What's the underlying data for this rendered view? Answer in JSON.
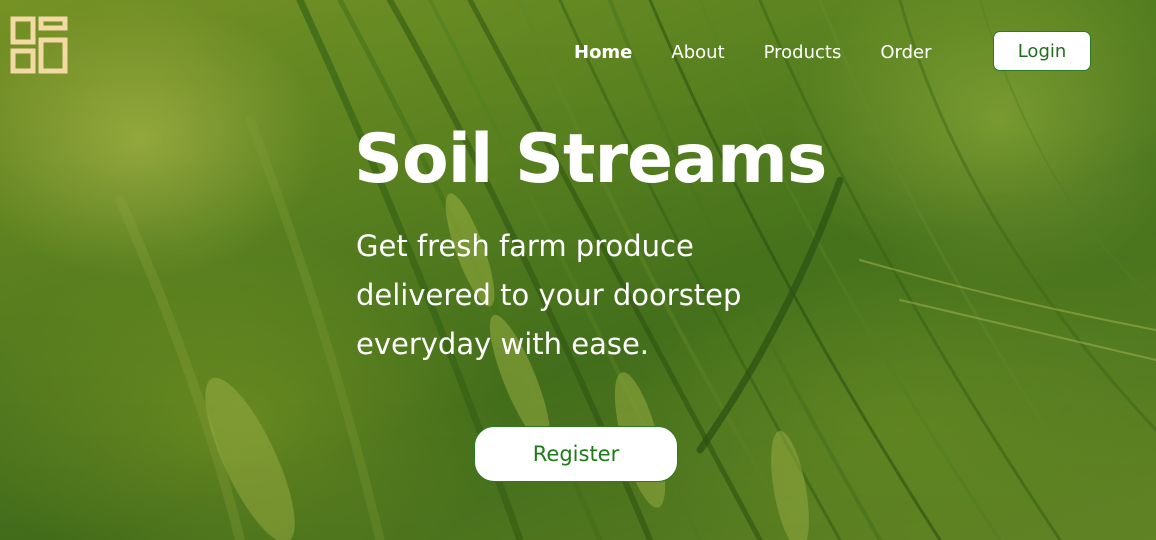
{
  "brand": {
    "logo_icon": "grid-squares-icon",
    "logo_color": "#f3d9a4"
  },
  "nav": {
    "items": [
      {
        "label": "Home",
        "active": true
      },
      {
        "label": "About",
        "active": false
      },
      {
        "label": "Products",
        "active": false
      },
      {
        "label": "Order",
        "active": false
      }
    ],
    "login_label": "Login"
  },
  "hero": {
    "title": "Soil Streams",
    "subtitle": "Get fresh farm produce delivered to your doorstep everyday with ease.",
    "cta_label": "Register",
    "background": "green-wheat-field-photo"
  },
  "colors": {
    "accent_green": "#1f7a1a",
    "text_white": "#ffffff"
  }
}
